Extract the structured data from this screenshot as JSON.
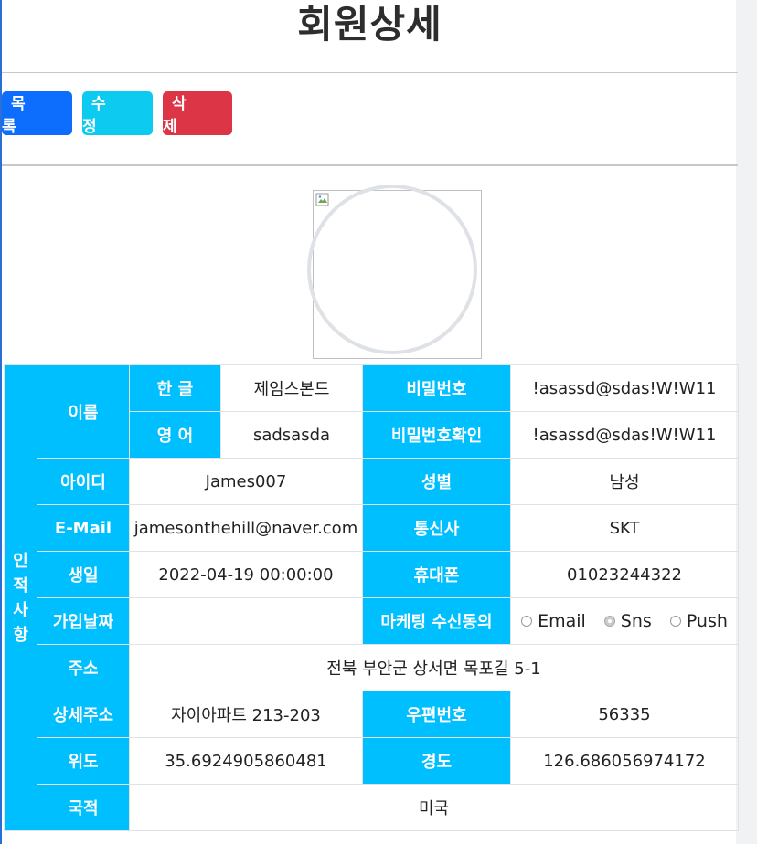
{
  "page": {
    "title": "회원상세"
  },
  "toolbar": {
    "list_label": "목 록",
    "edit_label": "수 정",
    "delete_label": "삭 제"
  },
  "section_label_chars": [
    "인",
    "적",
    "사",
    "항"
  ],
  "labels": {
    "name": "이름",
    "korean": "한 글",
    "english": "영 어",
    "password": "비밀번호",
    "password_confirm": "비밀번호확인",
    "user_id": "아이디",
    "gender": "성별",
    "email": "E-Mail",
    "carrier": "통신사",
    "birth": "생일",
    "phone": "휴대폰",
    "join_date": "가입날짜",
    "marketing": "마케팅 수신동의",
    "address": "주소",
    "address_detail": "상세주소",
    "zipcode": "우편번호",
    "latitude": "위도",
    "longitude": "경도",
    "nationality": "국적"
  },
  "member": {
    "name_korean": "제임스본드",
    "name_english": "sadsasda",
    "password": "!asassd@sdas!W!W11",
    "password_confirm": "!asassd@sdas!W!W11",
    "user_id": "James007",
    "gender": "남성",
    "email": "jamesonthehill@naver.com",
    "carrier": "SKT",
    "birth": "2022-04-19  00:00:00",
    "phone": "01023244322",
    "join_date": "",
    "address": "전북 부안군 상서면 목포길 5-1",
    "address_detail": "자이아파트 213-203",
    "zipcode": "56335",
    "latitude": "35.6924905860481",
    "longitude": "126.686056974172",
    "nationality": "미국"
  },
  "marketing_options": [
    {
      "label": "Email",
      "selected": false
    },
    {
      "label": "Sns",
      "selected": true
    },
    {
      "label": "Push",
      "selected": false
    }
  ],
  "colors": {
    "header_cell": "#00bfff",
    "list_button": "#0d6efd",
    "edit_button": "#0dcaf0",
    "delete_button": "#dc3545"
  }
}
